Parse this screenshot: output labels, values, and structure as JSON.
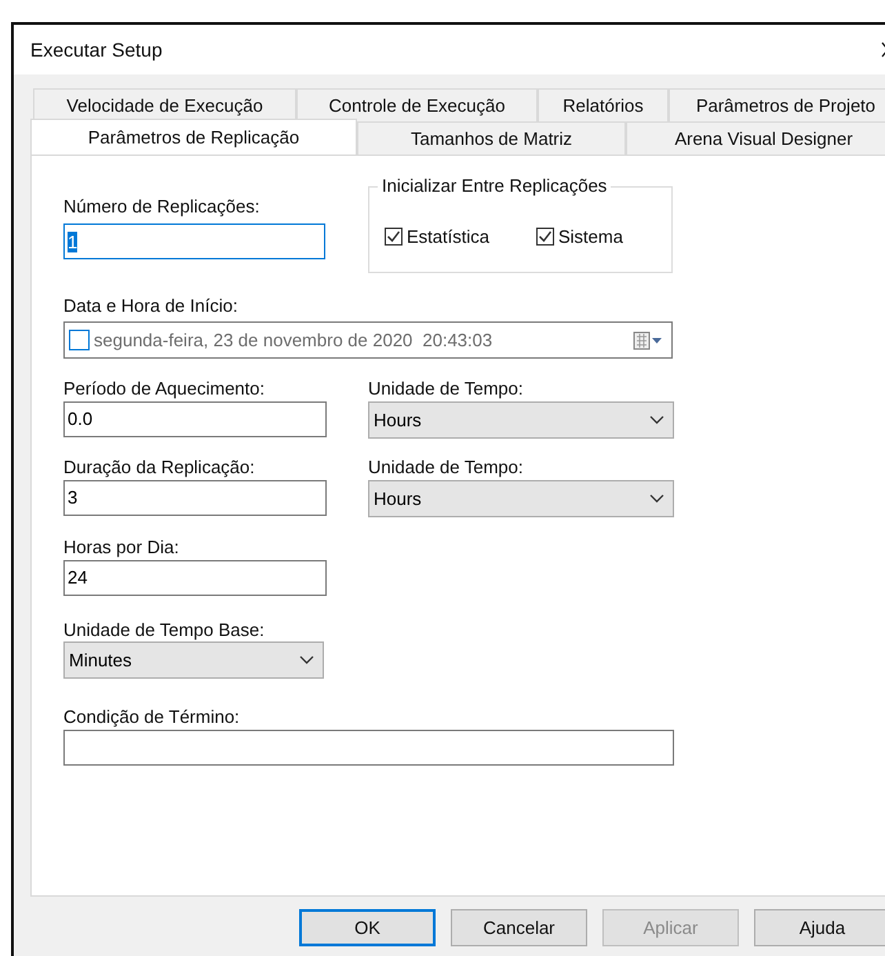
{
  "window": {
    "title": "Executar Setup"
  },
  "tab_rows": [
    [
      {
        "label": "Velocidade de Execução",
        "selected": false
      },
      {
        "label": "Controle de Execução",
        "selected": false
      },
      {
        "label": "Relatórios",
        "selected": false
      },
      {
        "label": "Parâmetros de Projeto",
        "selected": false
      }
    ],
    [
      {
        "label": "Parâmetros de Replicação",
        "selected": true
      },
      {
        "label": "Tamanhos de Matriz",
        "selected": false
      },
      {
        "label": "Arena Visual Designer",
        "selected": false
      }
    ]
  ],
  "replications": {
    "label": "Número de Replicações:",
    "value": "1"
  },
  "initialize_group": {
    "title": "Inicializar Entre Replicações",
    "checkboxes": [
      {
        "label": "Estatística",
        "checked": true
      },
      {
        "label": "Sistema",
        "checked": true
      }
    ]
  },
  "start_date": {
    "label": "Data e Hora de Início:",
    "checked": false,
    "value": "segunda-feira, 23 de novembro de 2020  20:43:03"
  },
  "warmup": {
    "label": "Período de Aquecimento:",
    "value": "0.0",
    "unit_label": "Unidade de Tempo:",
    "unit": "Hours"
  },
  "length": {
    "label": "Duração da Replicação:",
    "value": "3",
    "unit_label": "Unidade de Tempo:",
    "unit": "Hours"
  },
  "hours_per_day": {
    "label": "Horas por Dia:",
    "value": "24"
  },
  "base_unit": {
    "label": "Unidade de Tempo Base:",
    "value": "Minutes"
  },
  "terminating": {
    "label": "Condição de Término:"
  },
  "buttons": [
    {
      "label": "OK",
      "default": true,
      "disabled": false
    },
    {
      "label": "Cancelar",
      "default": false,
      "disabled": false
    },
    {
      "label": "Aplicar",
      "default": false,
      "disabled": true
    },
    {
      "label": "Ajuda",
      "default": false,
      "disabled": false
    }
  ]
}
